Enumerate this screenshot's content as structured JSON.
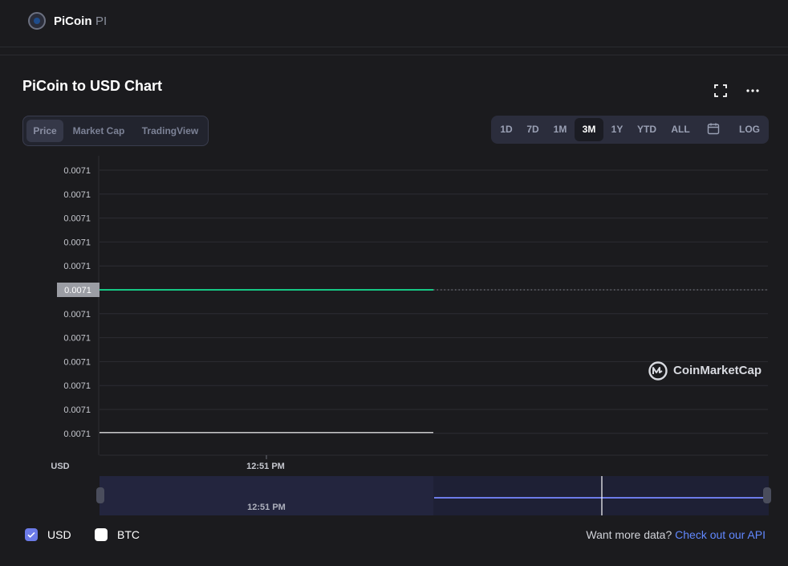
{
  "header": {
    "coin_name": "PiCoin",
    "coin_symbol": "PI",
    "logo_icon": "picoin-logo-icon"
  },
  "chart_section": {
    "title": "PiCoin to USD Chart",
    "tabs": [
      {
        "label": "Price",
        "active": true
      },
      {
        "label": "Market Cap",
        "active": false
      },
      {
        "label": "TradingView",
        "active": false
      }
    ],
    "ranges": [
      {
        "label": "1D",
        "active": false
      },
      {
        "label": "7D",
        "active": false
      },
      {
        "label": "1M",
        "active": false
      },
      {
        "label": "3M",
        "active": true
      },
      {
        "label": "1Y",
        "active": false
      },
      {
        "label": "YTD",
        "active": false
      },
      {
        "label": "ALL",
        "active": false
      },
      {
        "label": "calendar-icon",
        "active": false
      },
      {
        "label": "LOG",
        "active": false
      }
    ],
    "icons": {
      "expand": "expand-icon",
      "more": "more-options-icon",
      "brand": "coinmarketcap-logo-icon"
    },
    "watermark": "CoinMarketCap"
  },
  "chart_data": {
    "type": "line",
    "y_tick_labels": [
      "0.0071",
      "0.0071",
      "0.0071",
      "0.0071",
      "0.0071",
      "0.0071",
      "0.0071",
      "0.0071",
      "0.0071",
      "0.0071",
      "0.0071",
      "0.0071"
    ],
    "current_price_label": "0.0071",
    "x_tick_labels": [
      "12:51 PM"
    ],
    "navigator_label": "12:51 PM",
    "ylabel": "USD",
    "series": [
      {
        "name": "USD",
        "values": [
          0.0071,
          0.0071
        ],
        "color": "#16c784"
      },
      {
        "name": "BTC",
        "values": [
          0.0071,
          0.0071
        ],
        "color": "#ffffff"
      }
    ],
    "grid": true,
    "accent_color": "#16c784",
    "navigator_color": "#6c7be8"
  },
  "legend": [
    {
      "label": "USD",
      "checked": true,
      "color": "#6c7be8"
    },
    {
      "label": "BTC",
      "checked": false,
      "color": "#ffffff"
    }
  ],
  "footer": {
    "text": "Want more data?",
    "link": "Check out our API"
  }
}
